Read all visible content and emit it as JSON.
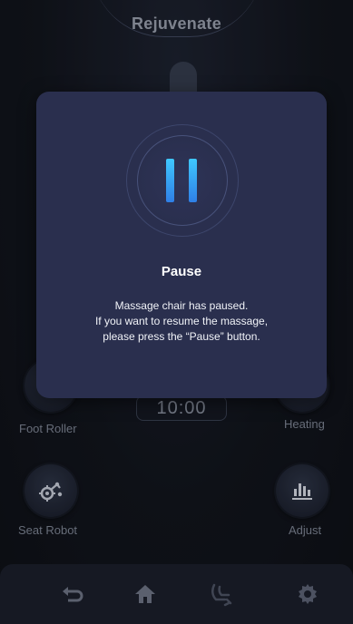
{
  "header": {
    "title": "Rejuvenate"
  },
  "controls": {
    "foot_roller": "Foot Roller",
    "heating": "Heating",
    "seat_robot": "Seat Robot",
    "adjust": "Adjust",
    "timer": "10:00"
  },
  "nav": {
    "icons": [
      "back-icon",
      "home-icon",
      "massage-mode-icon",
      "settings-icon"
    ]
  },
  "modal": {
    "title": "Pause",
    "line1": "Massage chair has paused.",
    "line2": "If you want to resume the massage,",
    "line3": "please press the “Pause” button."
  },
  "colors": {
    "accent_start": "#3fc8ff",
    "accent_end": "#2f7fe6",
    "modal_bg": "#2a2f4e"
  }
}
